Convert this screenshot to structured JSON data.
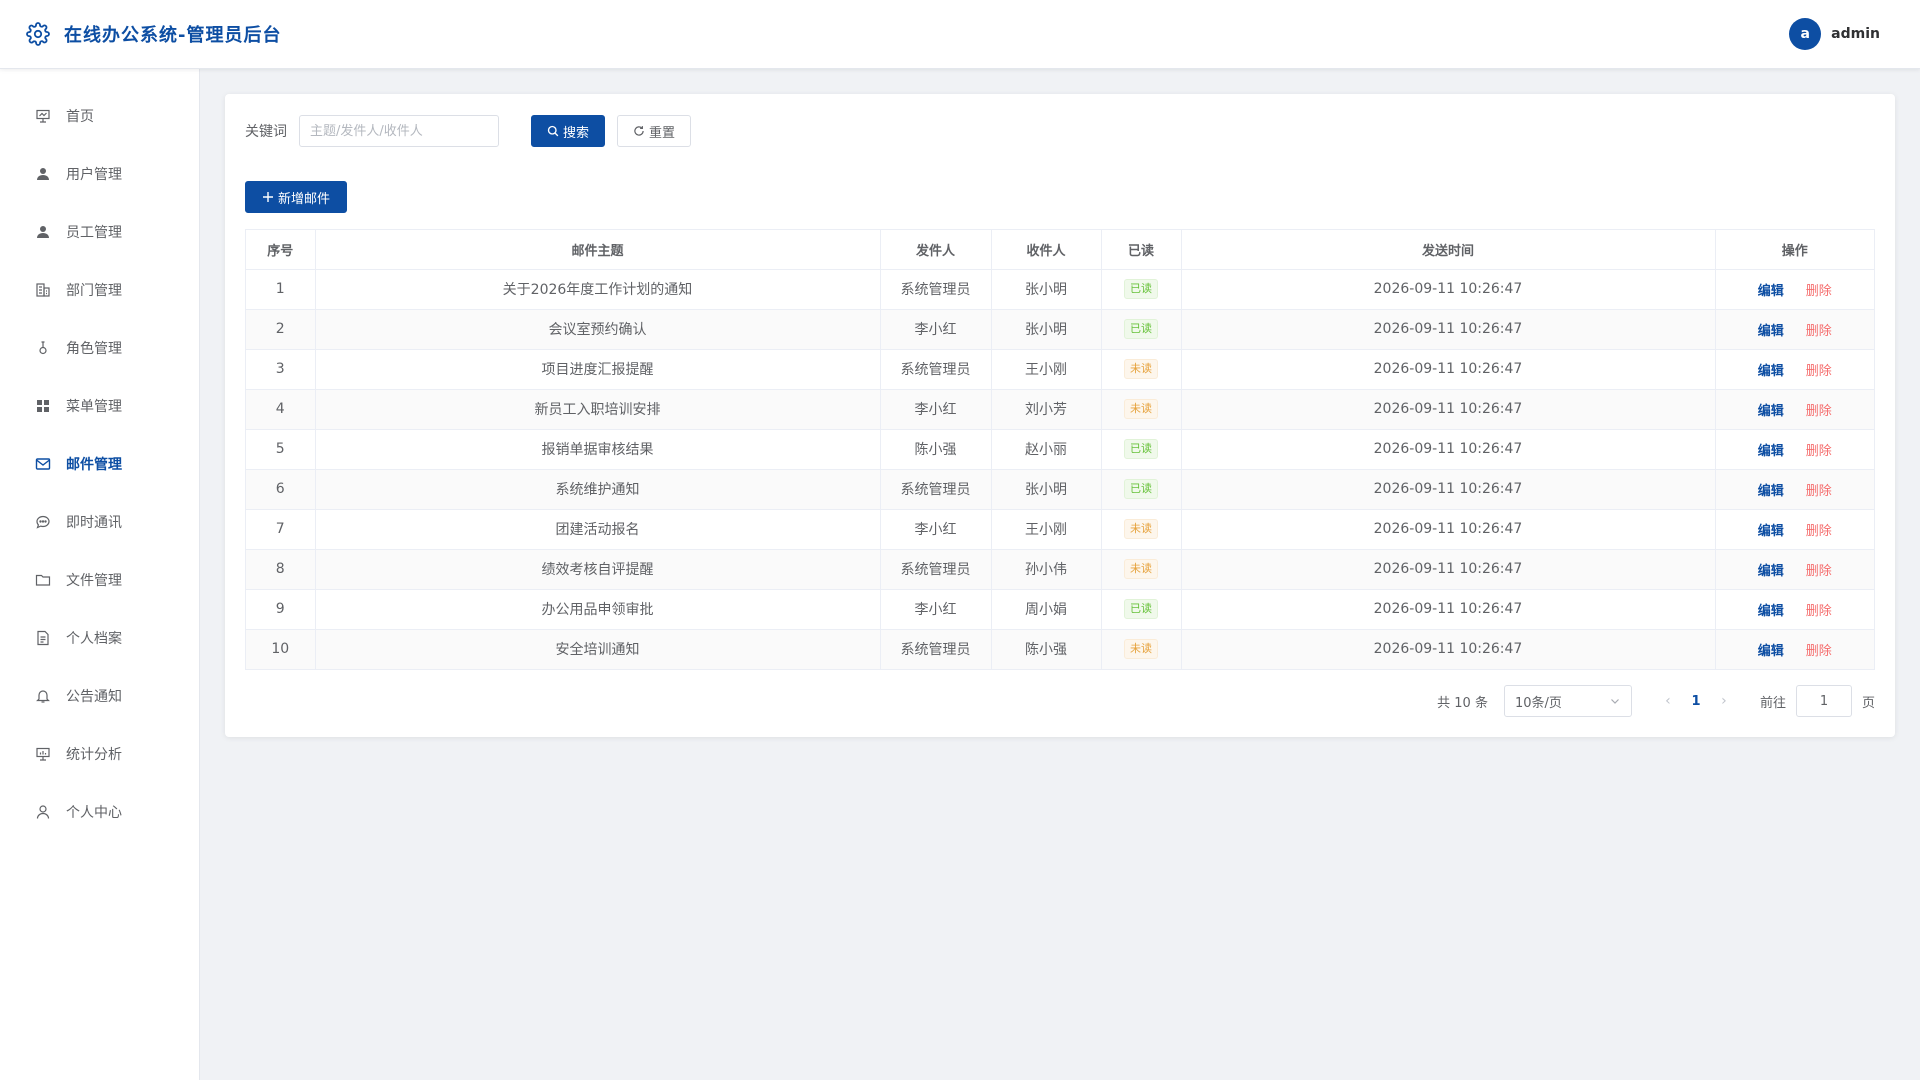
{
  "header": {
    "title": "在线办公系统-管理员后台",
    "avatar_letter": "a",
    "username": "admin"
  },
  "sidebar": {
    "items": [
      {
        "label": "首页",
        "icon": "presentation-icon",
        "active": false
      },
      {
        "label": "用户管理",
        "icon": "user-icon",
        "active": false
      },
      {
        "label": "员工管理",
        "icon": "user-icon",
        "active": false
      },
      {
        "label": "部门管理",
        "icon": "building-icon",
        "active": false
      },
      {
        "label": "角色管理",
        "icon": "badge-icon",
        "active": false
      },
      {
        "label": "菜单管理",
        "icon": "grid-icon",
        "active": false
      },
      {
        "label": "邮件管理",
        "icon": "mail-icon",
        "active": true
      },
      {
        "label": "即时通讯",
        "icon": "chat-icon",
        "active": false
      },
      {
        "label": "文件管理",
        "icon": "folder-icon",
        "active": false
      },
      {
        "label": "个人档案",
        "icon": "document-icon",
        "active": false
      },
      {
        "label": "公告通知",
        "icon": "bell-icon",
        "active": false
      },
      {
        "label": "统计分析",
        "icon": "chart-board-icon",
        "active": false
      },
      {
        "label": "个人中心",
        "icon": "person-outline-icon",
        "active": false
      }
    ]
  },
  "search": {
    "label": "关键词",
    "placeholder": "主题/发件人/收件人",
    "value": "",
    "search_button": "搜索",
    "reset_button": "重置"
  },
  "toolbar": {
    "add_button": "新增邮件"
  },
  "table": {
    "columns": [
      "序号",
      "邮件主题",
      "发件人",
      "收件人",
      "已读",
      "发送时间",
      "操作"
    ],
    "edit_label": "编辑",
    "delete_label": "删除",
    "rows": [
      {
        "no": "1",
        "subject": "关于2026年度工作计划的通知",
        "sender": "系统管理员",
        "receiver": "张小明",
        "read": "已读",
        "is_read": true,
        "time": "2026-09-11 10:26:47"
      },
      {
        "no": "2",
        "subject": "会议室预约确认",
        "sender": "李小红",
        "receiver": "张小明",
        "read": "已读",
        "is_read": true,
        "time": "2026-09-11 10:26:47"
      },
      {
        "no": "3",
        "subject": "项目进度汇报提醒",
        "sender": "系统管理员",
        "receiver": "王小刚",
        "read": "未读",
        "is_read": false,
        "time": "2026-09-11 10:26:47"
      },
      {
        "no": "4",
        "subject": "新员工入职培训安排",
        "sender": "李小红",
        "receiver": "刘小芳",
        "read": "未读",
        "is_read": false,
        "time": "2026-09-11 10:26:47"
      },
      {
        "no": "5",
        "subject": "报销单据审核结果",
        "sender": "陈小强",
        "receiver": "赵小丽",
        "read": "已读",
        "is_read": true,
        "time": "2026-09-11 10:26:47"
      },
      {
        "no": "6",
        "subject": "系统维护通知",
        "sender": "系统管理员",
        "receiver": "张小明",
        "read": "已读",
        "is_read": true,
        "time": "2026-09-11 10:26:47"
      },
      {
        "no": "7",
        "subject": "团建活动报名",
        "sender": "李小红",
        "receiver": "王小刚",
        "read": "未读",
        "is_read": false,
        "time": "2026-09-11 10:26:47"
      },
      {
        "no": "8",
        "subject": "绩效考核自评提醒",
        "sender": "系统管理员",
        "receiver": "孙小伟",
        "read": "未读",
        "is_read": false,
        "time": "2026-09-11 10:26:47"
      },
      {
        "no": "9",
        "subject": "办公用品申领审批",
        "sender": "李小红",
        "receiver": "周小娟",
        "read": "已读",
        "is_read": true,
        "time": "2026-09-11 10:26:47"
      },
      {
        "no": "10",
        "subject": "安全培训通知",
        "sender": "系统管理员",
        "receiver": "陈小强",
        "read": "未读",
        "is_read": false,
        "time": "2026-09-11 10:26:47"
      }
    ]
  },
  "pagination": {
    "total_text": "共 10 条",
    "page_size": "10条/页",
    "current_page": "1",
    "goto_label": "前往",
    "goto_value": "1",
    "page_suffix": "页"
  },
  "colors": {
    "primary": "#0d4ea3",
    "danger": "#f56c6c",
    "success": "#67c23a",
    "warning": "#e6a23c"
  }
}
